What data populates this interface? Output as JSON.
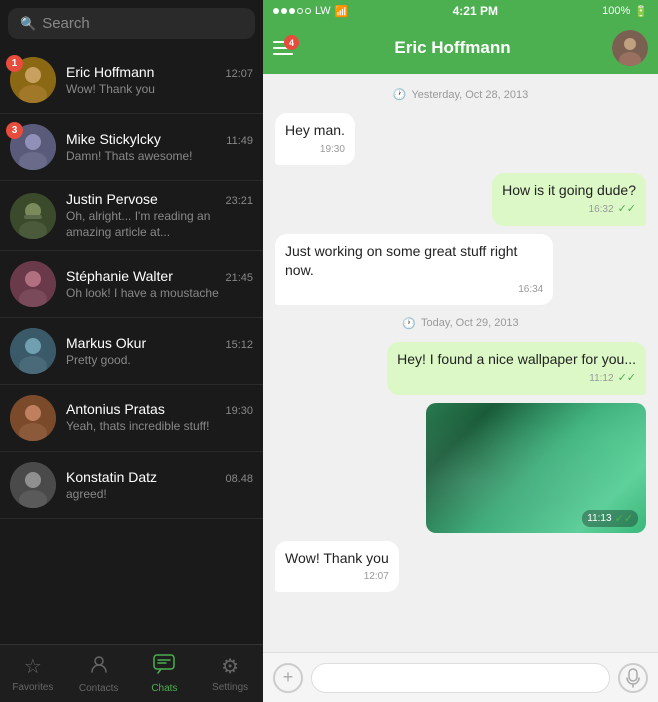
{
  "statusBar": {
    "dots": [
      "full",
      "full",
      "full",
      "empty",
      "empty"
    ],
    "carrier": "LW",
    "time": "4:21 PM",
    "battery": "100%"
  },
  "chatHeader": {
    "title": "Eric Hoffmann",
    "menuBadge": "4"
  },
  "search": {
    "placeholder": "Search"
  },
  "chats": [
    {
      "id": 1,
      "name": "Eric Hoffmann",
      "time": "12:07",
      "preview": "Wow! Thank you",
      "badge": "1",
      "avatarClass": "av1"
    },
    {
      "id": 2,
      "name": "Mike Stickylcky",
      "time": "11:49",
      "preview": "Damn! Thats awesome!",
      "badge": "3",
      "avatarClass": "av2"
    },
    {
      "id": 3,
      "name": "Justin Pervose",
      "time": "23:21",
      "preview": "Oh, alright... I'm reading an amazing article at...",
      "badge": "",
      "avatarClass": "av3"
    },
    {
      "id": 4,
      "name": "Stéphanie Walter",
      "time": "21:45",
      "preview": "Oh look! I have a moustache",
      "badge": "",
      "avatarClass": "av4"
    },
    {
      "id": 5,
      "name": "Markus Okur",
      "time": "15:12",
      "preview": "Pretty good.",
      "badge": "",
      "avatarClass": "av5"
    },
    {
      "id": 6,
      "name": "Antonius Pratas",
      "time": "19:30",
      "preview": "Yeah, thats incredible stuff!",
      "badge": "",
      "avatarClass": "av6"
    },
    {
      "id": 7,
      "name": "Konstatin Datz",
      "time": "08.48",
      "preview": "agreed!",
      "badge": "",
      "avatarClass": "av7"
    }
  ],
  "bottomNav": {
    "items": [
      {
        "label": "Favorites",
        "icon": "☆",
        "active": false
      },
      {
        "label": "Contacts",
        "icon": "👤",
        "active": false
      },
      {
        "label": "Chats",
        "icon": "💬",
        "active": true
      },
      {
        "label": "Settings",
        "icon": "⚙",
        "active": false
      }
    ]
  },
  "messages": {
    "date1": "Yesterday, Oct 28, 2013",
    "date2": "Today, Oct 29, 2013",
    "bubbles": [
      {
        "id": 1,
        "type": "received",
        "text": "Hey man.",
        "time": "19:30",
        "checks": ""
      },
      {
        "id": 2,
        "type": "sent",
        "text": "How is it going dude?",
        "time": "16:32",
        "checks": "✓✓"
      },
      {
        "id": 3,
        "type": "received",
        "text": "Just working on some great stuff right now.",
        "time": "16:34",
        "checks": ""
      },
      {
        "id": 4,
        "type": "sent",
        "text": "Hey! I found a nice wallpaper for you...",
        "time": "11:12",
        "checks": "✓✓"
      },
      {
        "id": 5,
        "type": "image",
        "time": "11:13",
        "checks": "✓✓"
      },
      {
        "id": 6,
        "type": "received",
        "text": "Wow! Thank you",
        "time": "12:07",
        "checks": ""
      }
    ]
  },
  "input": {
    "placeholder": ""
  }
}
